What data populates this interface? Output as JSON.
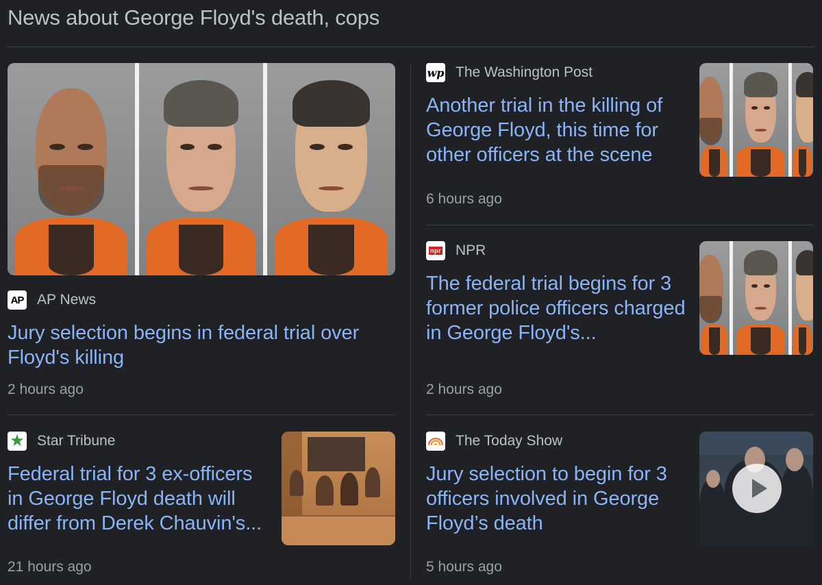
{
  "section_title": "News about George Floyd's death, cops",
  "articles": [
    {
      "source": "AP News",
      "logo_text": "AP",
      "title": "Jury selection begins in federal trial over Floyd's killing",
      "time": "2 hours ago",
      "thumbnail": "mugshots-three-officers"
    },
    {
      "source": "The Washington Post",
      "logo_text": "wp",
      "title": "Another trial in the killing of George Floyd, this time for other officers at the scene",
      "time": "6 hours ago",
      "thumbnail": "mugshots-three-officers"
    },
    {
      "source": "NPR",
      "logo_text": "npr",
      "title": "The federal trial begins for 3 former police officers charged in George Floyd's...",
      "time": "2 hours ago",
      "thumbnail": "mugshots-three-officers"
    },
    {
      "source": "Star Tribune",
      "logo_text": "★",
      "title": "Federal trial for 3 ex-officers in George Floyd death will differ from Derek Chauvin's...",
      "time": "21 hours ago",
      "thumbnail": "courtroom-sketch"
    },
    {
      "source": "The Today Show",
      "logo_text": "",
      "title": "Jury selection to begin for 3 officers involved in George Floyd’s death",
      "time": "5 hours ago",
      "thumbnail": "officers-walking-video"
    }
  ],
  "colors": {
    "background": "#202124",
    "headline": "#8ab4f8",
    "meta": "#9aa0a6",
    "divider": "#3c4043"
  }
}
